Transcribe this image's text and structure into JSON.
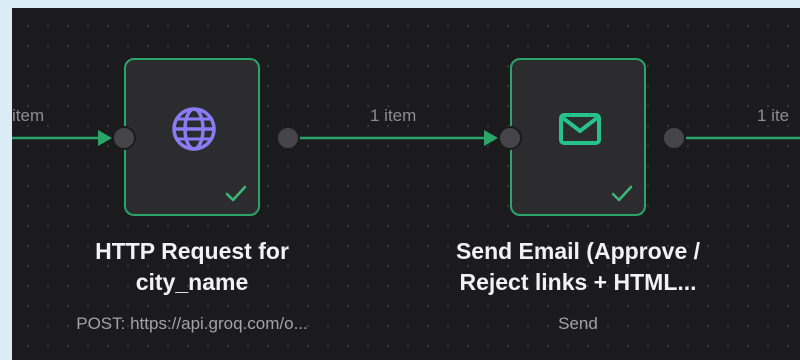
{
  "connections": [
    {
      "label": "item"
    },
    {
      "label": "1 item"
    },
    {
      "label": "1 ite"
    }
  ],
  "nodes": [
    {
      "icon": "globe-icon",
      "title_lines": [
        "HTTP Request for",
        "city_name"
      ],
      "subtitle": "POST: https://api.groq.com/o...",
      "status": "success"
    },
    {
      "icon": "mail-icon",
      "title_lines": [
        "Send Email (Approve /",
        "Reject links + HTML..."
      ],
      "subtitle": "Send",
      "status": "success"
    }
  ],
  "colors": {
    "canvas_bg": "#1b1b1d",
    "connection_green": "#2aa56a",
    "globe_icon": "#8b7cf6",
    "mail_icon": "#25c28a",
    "check_green": "#3cb878"
  }
}
